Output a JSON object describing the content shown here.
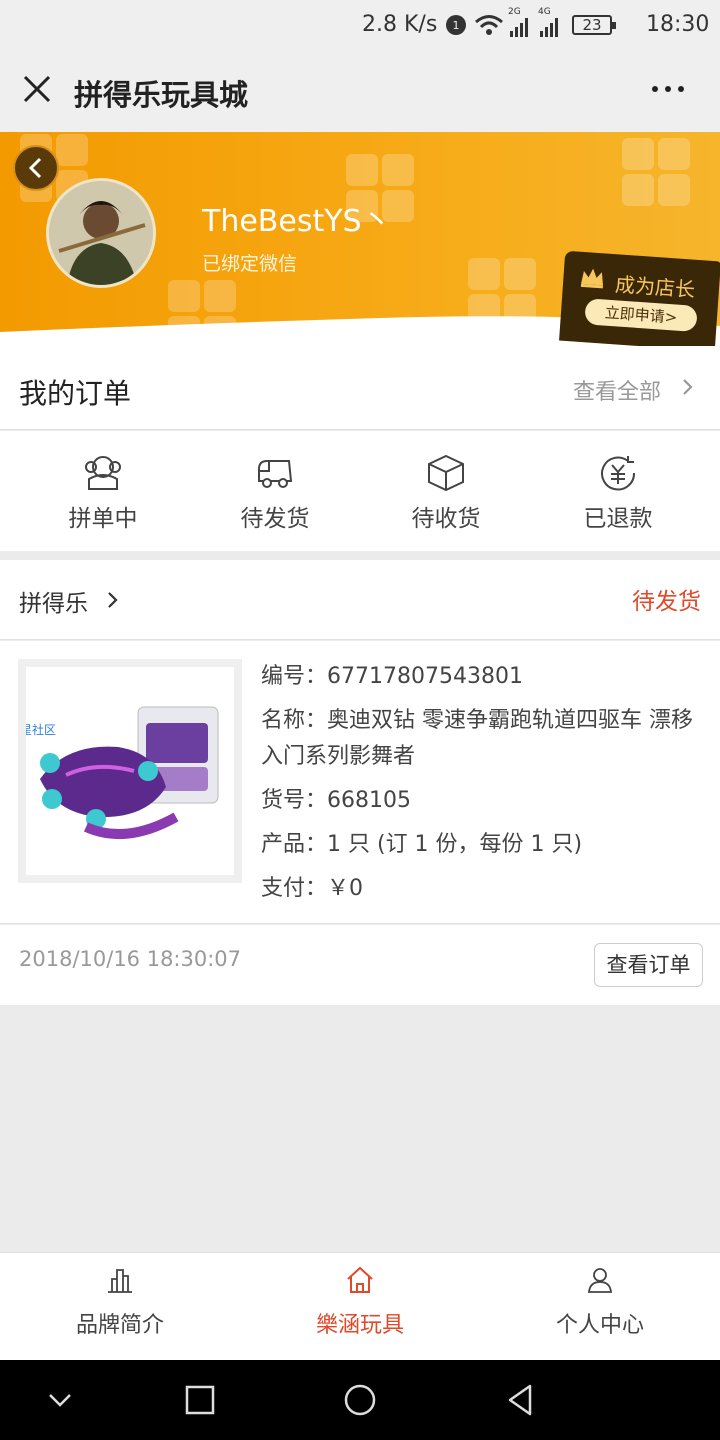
{
  "status_bar": {
    "speed": "2.8 K/s",
    "network_2g": "2G",
    "network_4g": "4G",
    "battery": "23",
    "time": "18:30"
  },
  "title_bar": {
    "title": "拼得乐玩具城",
    "close_icon": "close-icon",
    "more_icon": "more-icon"
  },
  "profile": {
    "username": "TheBestYS丶",
    "bind_status": "已绑定微信",
    "shopkeeper_title": "成为店长",
    "shopkeeper_apply": "立即申请>"
  },
  "orders": {
    "title": "我的订单",
    "view_all": "查看全部",
    "statuses": [
      {
        "label": "拼单中",
        "icon": "group-icon"
      },
      {
        "label": "待发货",
        "icon": "truck-icon"
      },
      {
        "label": "待收货",
        "icon": "box-icon"
      },
      {
        "label": "已退款",
        "icon": "refund-icon"
      }
    ]
  },
  "order": {
    "shop": "拼得乐",
    "status": "待发货",
    "watermark": "流星社区",
    "number": "编号：67717807543801",
    "name": "名称：奥迪双钻 零速争霸跑轨道四驱车 漂移入门系列影舞者",
    "item_no": "货号：668105",
    "product": "产品：1 只 (订 1 份，每份 1 只)",
    "payment": "支付：￥0",
    "date": "2018/10/16 18:30:07",
    "view_button": "查看订单"
  },
  "bottom_nav": {
    "items": [
      {
        "label": "品牌简介",
        "icon": "bar-chart-icon"
      },
      {
        "label": "樂涵玩具",
        "icon": "home-icon"
      },
      {
        "label": "个人中心",
        "icon": "user-icon"
      }
    ],
    "active_index": 1
  },
  "colors": {
    "accent": "#e0492a",
    "banner": "#f39a00"
  }
}
